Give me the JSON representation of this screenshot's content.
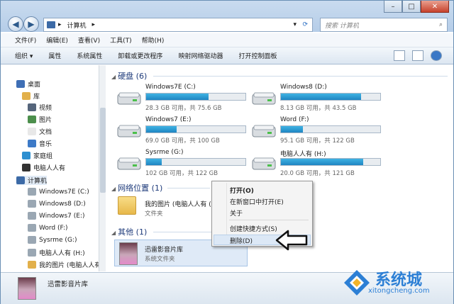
{
  "address": {
    "path": [
      "计算机"
    ]
  },
  "search": {
    "placeholder": "搜索 计算机"
  },
  "menubar": [
    "文件(F)",
    "编辑(E)",
    "查看(V)",
    "工具(T)",
    "帮助(H)"
  ],
  "toolbar": [
    "组织 ▾",
    "属性",
    "系统属性",
    "卸载或更改程序",
    "映射网络驱动器",
    "打开控制面板"
  ],
  "nav": {
    "items": [
      {
        "label": "桌面",
        "color": "#3f6fb5"
      },
      {
        "label": "库",
        "color": "#e2b04b"
      },
      {
        "label": "视频",
        "color": "#55657b"
      },
      {
        "label": "图片",
        "color": "#4c8f4c"
      },
      {
        "label": "文档",
        "color": "#e8e8e8"
      },
      {
        "label": "音乐",
        "color": "#3d7ac7"
      },
      {
        "label": "家庭组",
        "color": "#2d8fd0"
      },
      {
        "label": "电脑人人有",
        "color": "#333333"
      },
      {
        "label": "计算机",
        "color": "#3c6aa6"
      },
      {
        "label": "Windows7E (C:)",
        "color": "#9aa7b3"
      },
      {
        "label": "Windows8 (D:)",
        "color": "#9aa7b3"
      },
      {
        "label": "Windows7 (E:)",
        "color": "#9aa7b3"
      },
      {
        "label": "Word (F:)",
        "color": "#9aa7b3"
      },
      {
        "label": "Sysrme (G:)",
        "color": "#9aa7b3"
      },
      {
        "label": "电脑人人有 (H:)",
        "color": "#9aa7b3"
      },
      {
        "label": "我的图片 (电脑人人有",
        "color": "#e2b04b"
      }
    ]
  },
  "sections": {
    "drives": "硬盘 (6)",
    "network": "网络位置 (1)",
    "other": "其他 (1)"
  },
  "drives": [
    {
      "name": "Windows7E (C:)",
      "size": "28.3 GB 可用，共 75.6 GB",
      "used": 0.63
    },
    {
      "name": "Windows8 (D:)",
      "size": "8.13 GB 可用，共 43.5 GB",
      "used": 0.81
    },
    {
      "name": "Windows7 (E:)",
      "size": "69.0 GB 可用，共 100 GB",
      "used": 0.31
    },
    {
      "name": "Word (F:)",
      "size": "95.1 GB 可用，共 122 GB",
      "used": 0.22
    },
    {
      "name": "Sysrme (G:)",
      "size": "102 GB 可用，共 122 GB",
      "used": 0.16
    },
    {
      "name": "电脑人人有 (H:)",
      "size": "20.0 GB 可用，共 121 GB",
      "used": 0.83
    }
  ],
  "network_item": {
    "name": "我的图片 (电脑人人有 (",
    "type": "文件夹"
  },
  "other_item": {
    "name": "迅雷影音片库",
    "type": "系统文件夹"
  },
  "context_menu": [
    "打开(O)",
    "在新窗口中打开(E)",
    "关于",
    "创建快捷方式(S)",
    "删除(D)"
  ],
  "status": {
    "name": "迅雷影音片库"
  },
  "watermark": {
    "text": "系统城",
    "url": "xitongcheng.com"
  }
}
